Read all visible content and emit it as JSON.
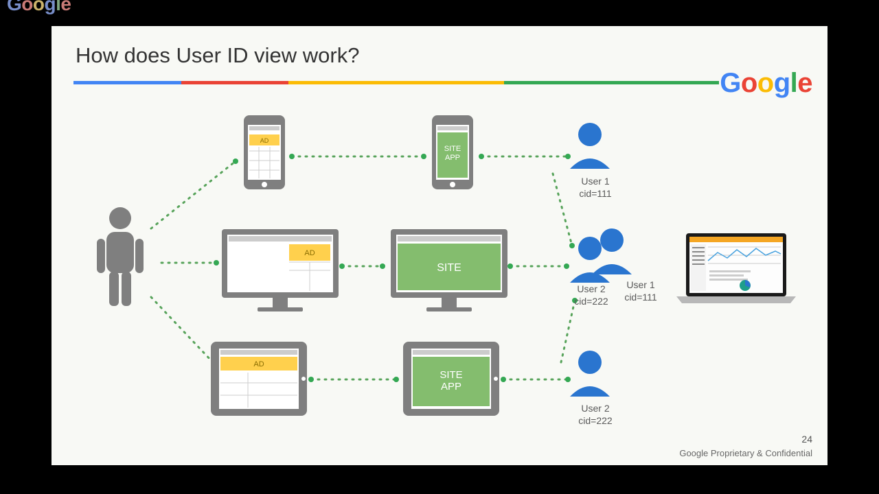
{
  "title": "How does User ID view work?",
  "brand": "Google",
  "rainbow": [
    "#4285F4",
    "#EA4335",
    "#FBBC05",
    "#FBBC05",
    "#34A853",
    "#34A853"
  ],
  "labels": {
    "ad": "AD",
    "site": "SITE",
    "site_app": "SITE\nAPP"
  },
  "users": {
    "u1": {
      "name": "User 1",
      "cid": "cid=111"
    },
    "mid_left": {
      "name": "User 2",
      "cid": "cid=222"
    },
    "mid_right": {
      "name": "User 1",
      "cid": "cid=111"
    },
    "u3": {
      "name": "User 2",
      "cid": "cid=222"
    }
  },
  "footer": "Google Proprietary & Confidential",
  "page": "24",
  "colors": {
    "grey": "#7f7f7f",
    "dgrey": "#5f5f5f",
    "yellow": "#fbbc05",
    "ybar": "#ffd04d",
    "green": "#84bd6e",
    "blue": "#2a75cf",
    "dashed": "#57a35a",
    "orange": "#f5a623"
  }
}
